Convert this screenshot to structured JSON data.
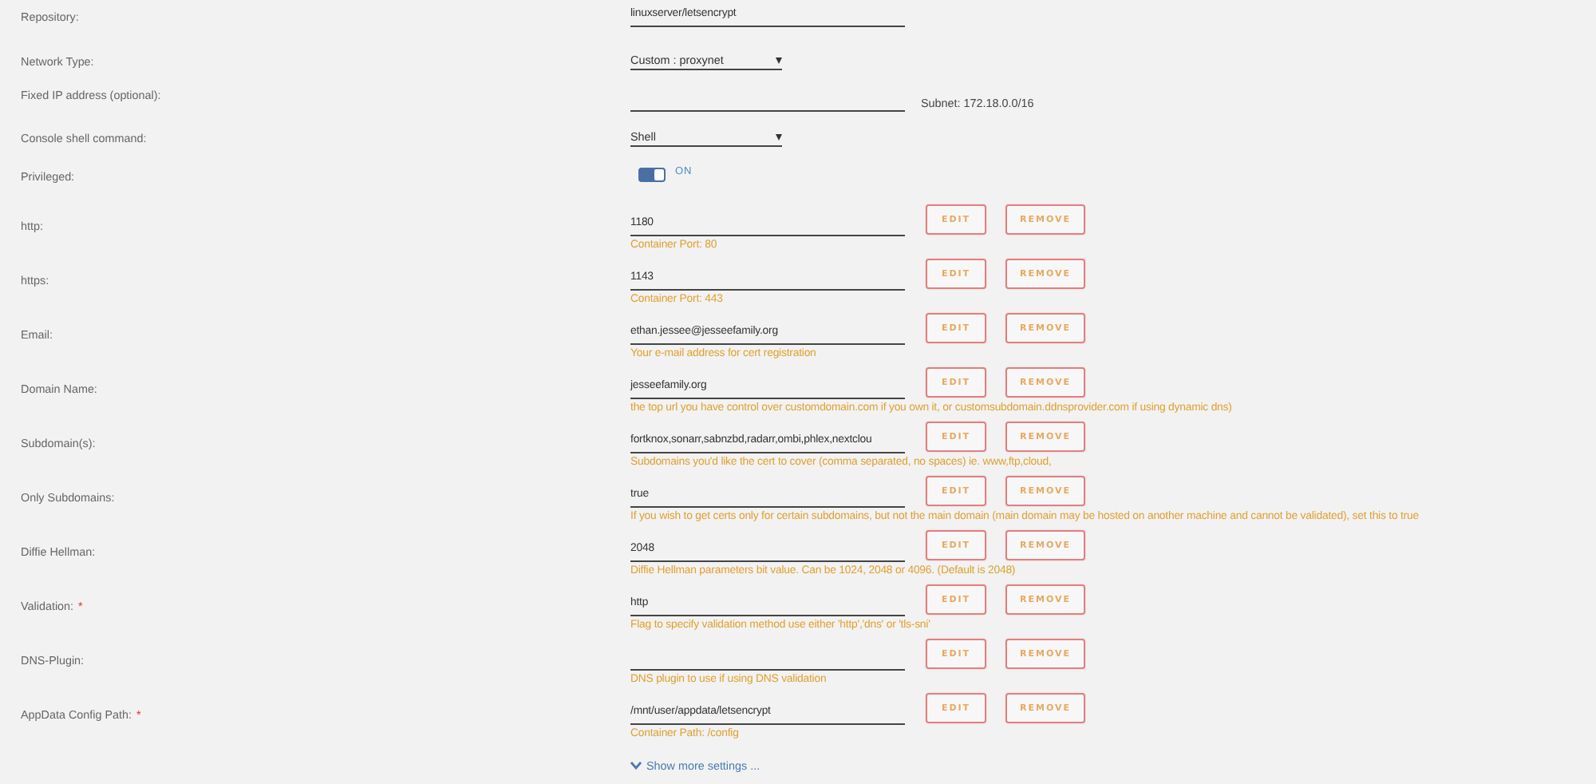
{
  "settings": [
    {
      "kind": "text",
      "label": "Repository:",
      "value": "linuxserver/letsencrypt"
    },
    {
      "kind": "select",
      "label": "Network Type:",
      "value": "Custom : proxynet"
    },
    {
      "kind": "text",
      "label": "Fixed IP address (optional):",
      "note": "Subnet: 172.18.0.0/16"
    },
    {
      "kind": "select",
      "label": "Console shell command:",
      "value": "Shell"
    },
    {
      "kind": "toggle",
      "label": "Privileged:",
      "on": true,
      "state_label": "ON"
    }
  ],
  "config": [
    {
      "label": "http:",
      "value": "1180",
      "description": "Container Port: 80",
      "edit": "EDIT",
      "remove": "REMOVE"
    },
    {
      "label": "https:",
      "value": "1143",
      "description": "Container Port: 443",
      "edit": "EDIT",
      "remove": "REMOVE"
    },
    {
      "label": "Email:",
      "value": "ethan.jessee@jesseefamily.org",
      "description": "Your e-mail address for cert registration",
      "edit": "EDIT",
      "remove": "REMOVE"
    },
    {
      "label": "Domain Name:",
      "value": "jesseefamily.org",
      "description": "the top url you have control over customdomain.com if you own it, or customsubdomain.ddnsprovider.com if using dynamic dns)",
      "edit": "EDIT",
      "remove": "REMOVE"
    },
    {
      "label": "Subdomain(s):",
      "value": "fortknox,sonarr,sabnzbd,radarr,ombi,phlex,nextclou",
      "description": "Subdomains you'd like the cert to cover (comma separated, no spaces) ie. www,ftp,cloud,",
      "edit": "EDIT",
      "remove": "REMOVE"
    },
    {
      "label": "Only Subdomains:",
      "value": "true",
      "description": "If you wish to get certs only for certain subdomains, but not the main domain (main domain may be hosted on another machine and cannot be validated), set this to true",
      "edit": "EDIT",
      "remove": "REMOVE"
    },
    {
      "label": "Diffie Hellman:",
      "value": "2048",
      "description": "Diffie Hellman parameters bit value. Can be 1024, 2048 or 4096. (Default is 2048)",
      "edit": "EDIT",
      "remove": "REMOVE"
    },
    {
      "label": "Validation:",
      "required_mark": "*",
      "value": "http",
      "description": "Flag to specify validation method use either 'http','dns' or 'tls-sni'",
      "edit": "EDIT",
      "remove": "REMOVE"
    },
    {
      "label": "DNS-Plugin:",
      "description": "DNS plugin to use if using DNS validation",
      "edit": "EDIT",
      "remove": "REMOVE"
    },
    {
      "label": "AppData Config Path:",
      "required_mark": "*",
      "value": "/mnt/user/appdata/letsencrypt",
      "description": "Container Path: /config",
      "edit": "EDIT",
      "remove": "REMOVE"
    }
  ],
  "show_more": "Show more settings ..."
}
